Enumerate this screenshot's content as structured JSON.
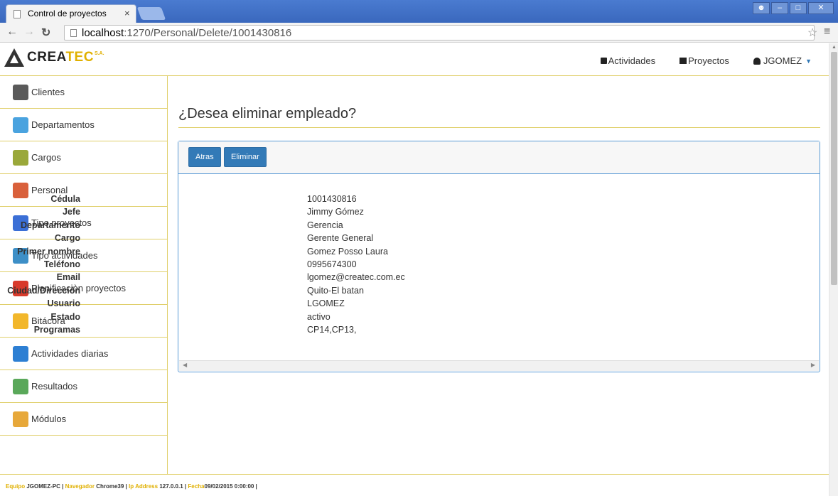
{
  "browser": {
    "tab_title": "Control de proyectos",
    "tab_close": "×",
    "url_host": "localhost",
    "url_rest": ":1270/Personal/Delete/1001430816"
  },
  "brand": {
    "name_main": "CREA",
    "name_accent": "TEC",
    "suffix": "S.A."
  },
  "topnav": {
    "actividades": "Actividades",
    "proyectos": "Proyectos",
    "user": "JGOMEZ"
  },
  "sidebar": {
    "items": [
      {
        "label": "Clientes",
        "icon": "client-icon",
        "color": "#5a5a5a"
      },
      {
        "label": "Departamentos",
        "icon": "house-icon",
        "color": "#4aa3df"
      },
      {
        "label": "Cargos",
        "icon": "clipboard-icon",
        "color": "#9aa83a"
      },
      {
        "label": "Personal",
        "icon": "people-icon",
        "color": "#d9603b"
      },
      {
        "label": "Tipo proyectos",
        "icon": "pen-chart-icon",
        "color": "#3b6fd6"
      },
      {
        "label": "Tipo actividades",
        "icon": "folder-blue-icon",
        "color": "#3d8fc7"
      },
      {
        "label": "Planificaciòn proyectos",
        "icon": "toolbox-icon",
        "color": "#d83a2b"
      },
      {
        "label": "Bitácora",
        "icon": "folder-icon",
        "color": "#f2b72b"
      },
      {
        "label": "Actividades diarias",
        "icon": "team-icon",
        "color": "#2d7fd3"
      },
      {
        "label": "Resultados",
        "icon": "spreadsheet-icon",
        "color": "#5aa85a"
      },
      {
        "label": "Módulos",
        "icon": "pencil-icon",
        "color": "#e7a83a"
      }
    ]
  },
  "main": {
    "heading": "¿Desea eliminar empleado?",
    "back_label": "Atras",
    "delete_label": "Eliminar",
    "fields": [
      {
        "label": "Cédula",
        "value": "1001430816"
      },
      {
        "label": "Jefe",
        "value": "Jimmy Gómez"
      },
      {
        "label": "Departamento",
        "value": "Gerencia"
      },
      {
        "label": "Cargo",
        "value": "Gerente General"
      },
      {
        "label": "Primer nombre",
        "value": "Gomez Posso Laura"
      },
      {
        "label": "Teléfono",
        "value": "0995674300"
      },
      {
        "label": "Email",
        "value": "lgomez@createc.com.ec"
      },
      {
        "label": "Ciudad/Dirección",
        "value": "Quito-El batan"
      },
      {
        "label": "Usuario",
        "value": "LGOMEZ"
      },
      {
        "label": "Estado",
        "value": "activo"
      },
      {
        "label": "Programas",
        "value": "CP14,CP13,"
      }
    ]
  },
  "footer": {
    "equipo_label": "Equipo",
    "equipo_value": "JGOMEZ-PC |",
    "navegador_label": "Navegador",
    "navegador_value": "Chrome39 |",
    "ip_label": "Ip Address",
    "ip_value": "127.0.0.1 |",
    "fecha_label": "Fecha",
    "fecha_value": "09/02/2015 0:00:00 |"
  },
  "colors": {
    "accent_gold": "#e0b000",
    "border_gold": "#e0cf6a",
    "button_blue": "#337ab7"
  }
}
